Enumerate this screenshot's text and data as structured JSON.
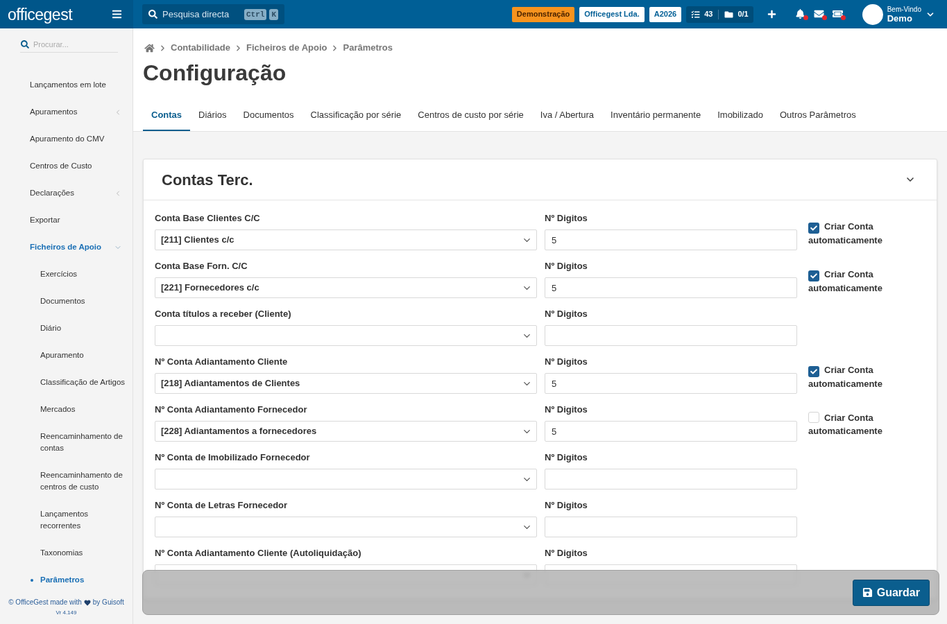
{
  "topbar": {
    "logo": "officegest",
    "search": {
      "placeholder": "Pesquisa directa",
      "keys": [
        "Ctrl",
        "K"
      ]
    },
    "badges": [
      {
        "label": "Demonstração",
        "kind": "demo"
      },
      {
        "label": "Officegest Lda.",
        "kind": "plain"
      },
      {
        "label": "A2026",
        "kind": "plain"
      }
    ],
    "counters": [
      "43",
      "0/1"
    ],
    "alerts": [
      {
        "unread": true
      },
      {
        "unread": true
      },
      {
        "unread": true
      }
    ],
    "user": {
      "greeting": "Bem-Vindo",
      "name": "Demo"
    }
  },
  "sidebar": {
    "search": {
      "placeholder": "Procurar..."
    },
    "items": [
      {
        "label": "Lançamentos em lote",
        "kind": "link",
        "selected": false
      },
      {
        "label": "Apuramentos",
        "kind": "group",
        "expanded": false,
        "selected": false
      },
      {
        "label": "Apuramento do CMV",
        "kind": "link",
        "selected": false
      },
      {
        "label": "Centros de Custo",
        "kind": "link",
        "selected": false
      },
      {
        "label": "Declarações",
        "kind": "group",
        "expanded": false,
        "selected": false
      },
      {
        "label": "Exportar",
        "kind": "link",
        "selected": false
      },
      {
        "label": "Ficheiros de Apoio",
        "kind": "group",
        "expanded": true,
        "selected": true,
        "children": [
          {
            "label": "Exercícios",
            "selected": false
          },
          {
            "label": "Documentos",
            "selected": false
          },
          {
            "label": "Diário",
            "selected": false
          },
          {
            "label": "Apuramento",
            "selected": false
          },
          {
            "label": "Classificação de Artigos",
            "selected": false
          },
          {
            "label": "Mercados",
            "selected": false
          },
          {
            "label": "Reencaminhamento de contas",
            "selected": false
          },
          {
            "label": "Reencaminhamento de centros de custo",
            "selected": false
          },
          {
            "label": "Lançamentos recorrentes",
            "selected": false
          },
          {
            "label": "Taxonomias",
            "selected": false
          },
          {
            "label": "Parâmetros",
            "selected": true
          }
        ]
      }
    ],
    "footer": {
      "credit_before": "© OfficeGest made with",
      "credit_after": "by Guisoft",
      "version": "Vr 4.149"
    }
  },
  "breadcrumb": [
    "Contabilidade",
    "Ficheiros de Apoio",
    "Parâmetros"
  ],
  "page_title": "Configuração",
  "tabs": [
    {
      "label": "Contas",
      "selected": true
    },
    {
      "label": "Diários",
      "selected": false
    },
    {
      "label": "Documentos",
      "selected": false
    },
    {
      "label": "Classificação por série",
      "selected": false
    },
    {
      "label": "Centros de custo por série",
      "selected": false
    },
    {
      "label": "Iva / Abertura",
      "selected": false
    },
    {
      "label": "Inventário permanente",
      "selected": false
    },
    {
      "label": "Imobilizado",
      "selected": false
    },
    {
      "label": "Outros Parâmetros",
      "selected": false
    }
  ],
  "card": {
    "title": "Contas Terc.",
    "expanded": true,
    "rows": [
      {
        "account_label": "Conta Base Clientes C/C",
        "account_value": "[211] Clientes c/c",
        "digits_label": "Nº Digitos",
        "digits_value": "5",
        "auto_create": {
          "label": "Criar Conta automaticamente",
          "checked": true
        }
      },
      {
        "account_label": "Conta Base Forn. C/C",
        "account_value": "[221] Fornecedores c/c",
        "digits_label": "Nº Digitos",
        "digits_value": "5",
        "auto_create": {
          "label": "Criar Conta automaticamente",
          "checked": true
        }
      },
      {
        "account_label": "Conta títulos a receber (Cliente)",
        "digits_label": "Nº Digitos"
      },
      {
        "account_label": "Nº Conta Adiantamento Cliente",
        "account_value": "[218] Adiantamentos de Clientes",
        "digits_label": "Nº Digitos",
        "digits_value": "5",
        "auto_create": {
          "label": "Criar Conta automaticamente",
          "checked": true
        }
      },
      {
        "account_label": "Nº Conta Adiantamento Fornecedor",
        "account_value": "[228] Adiantamentos a fornecedores",
        "digits_label": "Nº Digitos",
        "digits_value": "5",
        "auto_create": {
          "label": "Criar Conta automaticamente",
          "checked": false
        }
      },
      {
        "account_label": "Nº Conta de Imobilizado Fornecedor",
        "digits_label": "Nº Digitos"
      },
      {
        "account_label": "Nº Conta de Letras Fornecedor",
        "digits_label": "Nº Digitos"
      },
      {
        "account_label": "Nº Conta Adiantamento Cliente (Autoliquidação)",
        "digits_label": "Nº Digitos"
      }
    ]
  },
  "save_bar": {
    "button": "Guardar"
  }
}
